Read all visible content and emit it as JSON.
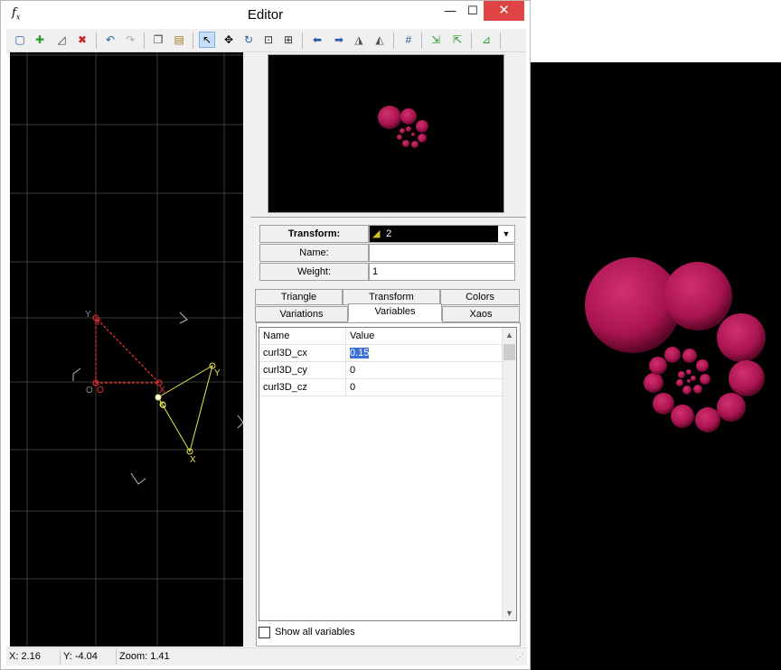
{
  "window": {
    "title": "Editor",
    "app_icon": "fx-icon",
    "minimize": "—",
    "maximize": "☐",
    "close": "✕"
  },
  "toolbar": {
    "buttons": [
      "new-icon",
      "add-icon",
      "duplicate-icon",
      "delete-icon",
      "undo-icon",
      "redo-icon",
      "copy-icon",
      "paste-icon",
      "select-icon",
      "move-icon",
      "rotate-icon",
      "scale-icon",
      "fit-icon",
      "left-icon",
      "right-icon",
      "flip-h-icon",
      "flip-v-icon",
      "grid-icon",
      "post-x-icon",
      "post-y-icon",
      "reset-icon"
    ]
  },
  "graph": {
    "triangle_red": {
      "o": "O",
      "x": "X",
      "y": "Y"
    },
    "triangle_yellow": {
      "o": "O",
      "x": "X",
      "y": "Y"
    },
    "colors": {
      "grid": "#3a3a3a",
      "red": "#ff3030",
      "yellow": "#e8e84a",
      "background": "#000000"
    }
  },
  "properties": {
    "transform_label": "Transform:",
    "transform_value": "2",
    "name_label": "Name:",
    "name_value": "",
    "weight_label": "Weight:",
    "weight_value": "1"
  },
  "tabs": {
    "row1": [
      "Triangle",
      "Transform",
      "Colors"
    ],
    "row2": [
      "Variations",
      "Variables",
      "Xaos"
    ],
    "active": "Variables"
  },
  "variables": {
    "headers": [
      "Name",
      "Value"
    ],
    "rows": [
      {
        "name": "curl3D_cx",
        "value": "0.15"
      },
      {
        "name": "curl3D_cy",
        "value": "0"
      },
      {
        "name": "curl3D_cz",
        "value": "0"
      }
    ]
  },
  "show_all_label": "Show all variables",
  "status": {
    "x": "X: 2.16",
    "y": "Y: -4.04",
    "zoom": "Zoom: 1.41"
  },
  "flame_color": "#c01858"
}
